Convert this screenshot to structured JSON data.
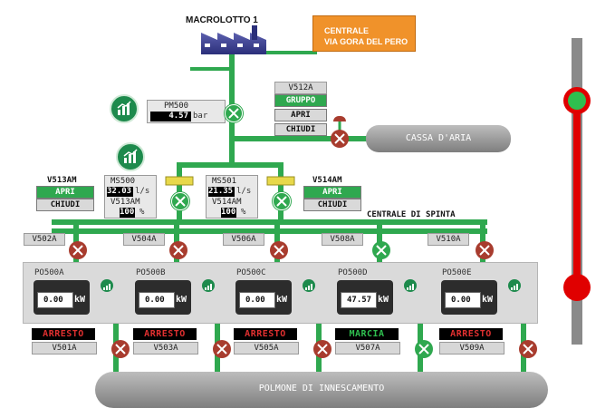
{
  "header": {
    "plant_label": "MACROLOTTO 1",
    "central_label_line1": "CENTRALE",
    "central_label_line2": "VIA GORA DEL PERO"
  },
  "pressure": {
    "tag": "PM500",
    "value": "4.57",
    "unit": "bar"
  },
  "valve_v512a": {
    "tag": "V512A",
    "buttons": [
      {
        "label": "GRUPPO",
        "active": true
      },
      {
        "label": "APRI",
        "active": false
      },
      {
        "label": "CHIUDI",
        "active": false
      }
    ]
  },
  "air_tank": {
    "label": "CASSA D'ARIA"
  },
  "valve_v513am": {
    "tag": "V513AM",
    "open_label": "APRI",
    "close_label": "CHIUDI"
  },
  "valve_v514am": {
    "tag": "V514AM",
    "open_label": "APRI",
    "close_label": "CHIUDI"
  },
  "flow_left": {
    "tag": "MS500",
    "value": "32.03",
    "unit": "l/s",
    "sub_tag": "V513AM",
    "sub_value": "100",
    "sub_unit": "%"
  },
  "flow_right": {
    "tag": "MS501",
    "value": "21.35",
    "unit": "l/s",
    "sub_tag": "V514AM",
    "sub_value": "100",
    "sub_unit": "%"
  },
  "section_label": "CENTRALE DI SPINTA",
  "top_valves": [
    {
      "tag": "V502A",
      "state": "closed"
    },
    {
      "tag": "V504A",
      "state": "closed"
    },
    {
      "tag": "V506A",
      "state": "closed"
    },
    {
      "tag": "V508A",
      "state": "open"
    },
    {
      "tag": "V510A",
      "state": "closed"
    }
  ],
  "pumps": [
    {
      "tag": "PO500A",
      "kw": "0.00",
      "kw_unit": "kW",
      "status": "ARRESTO",
      "running": false,
      "valve": "V501A"
    },
    {
      "tag": "PO500B",
      "kw": "0.00",
      "kw_unit": "kW",
      "status": "ARRESTO",
      "running": false,
      "valve": "V503A"
    },
    {
      "tag": "PO500C",
      "kw": "0.00",
      "kw_unit": "kW",
      "status": "ARRESTO",
      "running": false,
      "valve": "V505A"
    },
    {
      "tag": "PO500D",
      "kw": "47.57",
      "kw_unit": "kW",
      "status": "MARCIA",
      "running": true,
      "valve": "V507A"
    },
    {
      "tag": "PO500E",
      "kw": "0.00",
      "kw_unit": "kW",
      "status": "ARRESTO",
      "running": false,
      "valve": "V509A"
    }
  ],
  "priming_tank": {
    "label": "POLMONE DI INNESCAMENTO"
  },
  "level": {
    "top_status": "green",
    "bottom_status": "red"
  },
  "colors": {
    "pipe": "#2fa84f",
    "valve_closed": "#a83c2e",
    "valve_open": "#2fa84f",
    "status_red": "#e03030",
    "status_green": "#2fbf4f",
    "central": "#f0922a"
  }
}
